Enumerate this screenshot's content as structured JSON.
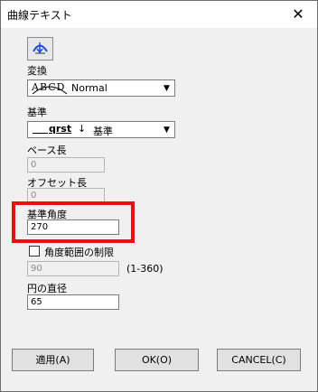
{
  "window": {
    "title": "曲線テキスト",
    "close_glyph": "✕"
  },
  "icon_button": {
    "icon": "curve-text-icon"
  },
  "henkan": {
    "label": "変換",
    "sample": "ABCD",
    "value": "Normal"
  },
  "kijun": {
    "label": "基準",
    "sample": "qrst",
    "value": "基準"
  },
  "base_length": {
    "label": "ベース長",
    "value": "0"
  },
  "offset_length": {
    "label": "オフセット長",
    "value": "0"
  },
  "base_angle": {
    "label": "基準角度",
    "value": "270"
  },
  "angle_limit": {
    "label": "角度範囲の制限",
    "checked": false,
    "value": "90",
    "range": "(1-360)"
  },
  "circle_diameter": {
    "label": "円の直径",
    "value": "65"
  },
  "buttons": {
    "apply": "適用(A)",
    "ok": "OK(O)",
    "cancel": "CANCEL(C)"
  },
  "colors": {
    "highlight_border": "#e51212"
  }
}
